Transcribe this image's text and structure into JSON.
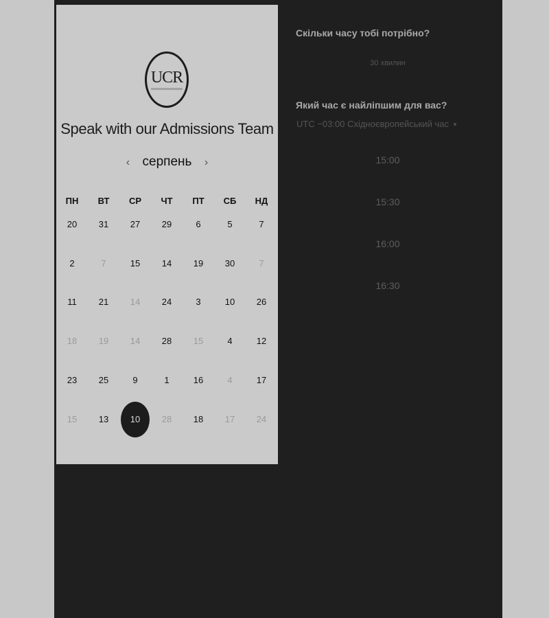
{
  "logo": {
    "text": "UCR"
  },
  "heading": "Speak with our Admissions Team",
  "calendar": {
    "month": "серпень",
    "prev": "‹",
    "next": "›",
    "weekdays": [
      "ПН",
      "ВТ",
      "СР",
      "ЧТ",
      "ПТ",
      "СБ",
      "НД"
    ],
    "rows": [
      [
        {
          "d": "20",
          "s": "n"
        },
        {
          "d": "31",
          "s": "n"
        },
        {
          "d": "27",
          "s": "n"
        },
        {
          "d": "29",
          "s": "n"
        },
        {
          "d": "6",
          "s": "n"
        },
        {
          "d": "5",
          "s": "n"
        },
        {
          "d": "7",
          "s": "n"
        }
      ],
      [
        {
          "d": "2",
          "s": "n"
        },
        {
          "d": "7",
          "s": "dim"
        },
        {
          "d": "15",
          "s": "n"
        },
        {
          "d": "14",
          "s": "n"
        },
        {
          "d": "19",
          "s": "n"
        },
        {
          "d": "30",
          "s": "n"
        },
        {
          "d": "7",
          "s": "dim"
        }
      ],
      [
        {
          "d": "11",
          "s": "n"
        },
        {
          "d": "21",
          "s": "n"
        },
        {
          "d": "14",
          "s": "dim"
        },
        {
          "d": "24",
          "s": "n"
        },
        {
          "d": "3",
          "s": "n"
        },
        {
          "d": "10",
          "s": "n"
        },
        {
          "d": "26",
          "s": "n"
        }
      ],
      [
        {
          "d": "18",
          "s": "dim"
        },
        {
          "d": "19",
          "s": "dim"
        },
        {
          "d": "14",
          "s": "dim"
        },
        {
          "d": "28",
          "s": "n"
        },
        {
          "d": "15",
          "s": "dim"
        },
        {
          "d": "4",
          "s": "n"
        },
        {
          "d": "12",
          "s": "n"
        }
      ],
      [
        {
          "d": "23",
          "s": "n"
        },
        {
          "d": "25",
          "s": "n"
        },
        {
          "d": "9",
          "s": "n"
        },
        {
          "d": "1",
          "s": "n"
        },
        {
          "d": "16",
          "s": "n"
        },
        {
          "d": "4",
          "s": "dim"
        },
        {
          "d": "17",
          "s": "n"
        }
      ],
      [
        {
          "d": "15",
          "s": "dim"
        },
        {
          "d": "13",
          "s": "n"
        },
        {
          "d": "10",
          "s": "sel"
        },
        {
          "d": "28",
          "s": "dim"
        },
        {
          "d": "18",
          "s": "n"
        },
        {
          "d": "17",
          "s": "dim"
        },
        {
          "d": "24",
          "s": "dim"
        }
      ]
    ]
  },
  "duration": {
    "question": "Скільки часу тобі потрібно?",
    "value": "30 хвилин"
  },
  "time": {
    "question": "Який час є найліпшим для вас?",
    "timezone": "UTC −03:00 Східноєвропейський час",
    "slots": [
      "15:00",
      "15:30",
      "16:00",
      "16:30"
    ]
  }
}
